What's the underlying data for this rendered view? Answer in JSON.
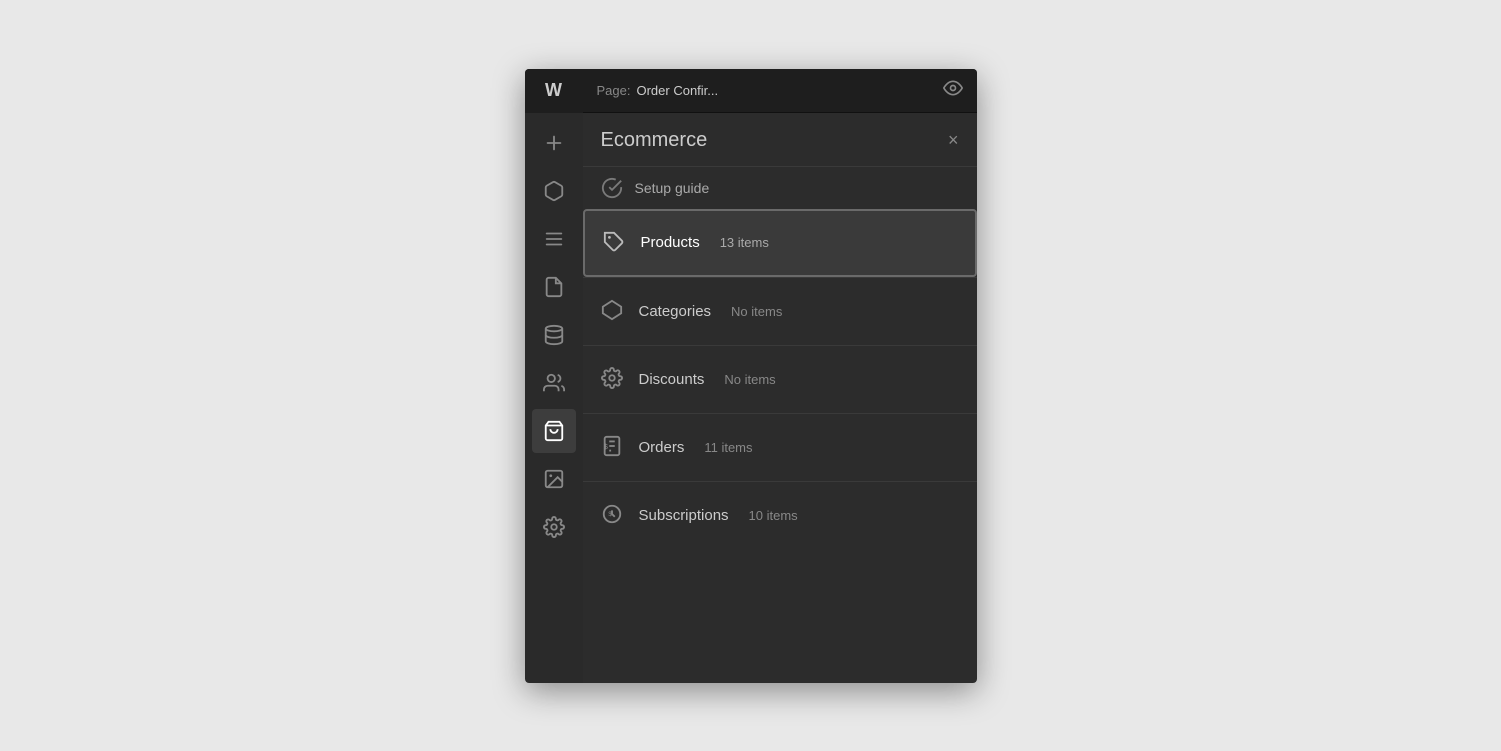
{
  "header": {
    "logo": "W",
    "page_label": "Page:",
    "page_name": "Order Confir...",
    "eye_icon": "👁"
  },
  "panel": {
    "title": "Ecommerce",
    "close_label": "×",
    "setup_guide_label": "Setup guide"
  },
  "sidebar": {
    "icons": [
      {
        "name": "add-icon",
        "symbol": "+"
      },
      {
        "name": "box-icon",
        "symbol": "⬡"
      },
      {
        "name": "list-icon",
        "symbol": "≡"
      },
      {
        "name": "file-icon",
        "symbol": "⬜"
      },
      {
        "name": "database-icon",
        "symbol": "⊙"
      },
      {
        "name": "users-icon",
        "symbol": "👥"
      },
      {
        "name": "cart-icon",
        "symbol": "🛒",
        "active": true
      },
      {
        "name": "image-icon",
        "symbol": "🖼"
      },
      {
        "name": "settings-icon",
        "symbol": "⚙"
      }
    ]
  },
  "menu_items": [
    {
      "id": "products",
      "name": "Products",
      "count": "13 items",
      "selected": true
    },
    {
      "id": "categories",
      "name": "Categories",
      "count": "No items",
      "selected": false
    },
    {
      "id": "discounts",
      "name": "Discounts",
      "count": "No items",
      "selected": false
    },
    {
      "id": "orders",
      "name": "Orders",
      "count": "11 items",
      "selected": false
    },
    {
      "id": "subscriptions",
      "name": "Subscriptions",
      "count": "10 items",
      "selected": false
    }
  ]
}
